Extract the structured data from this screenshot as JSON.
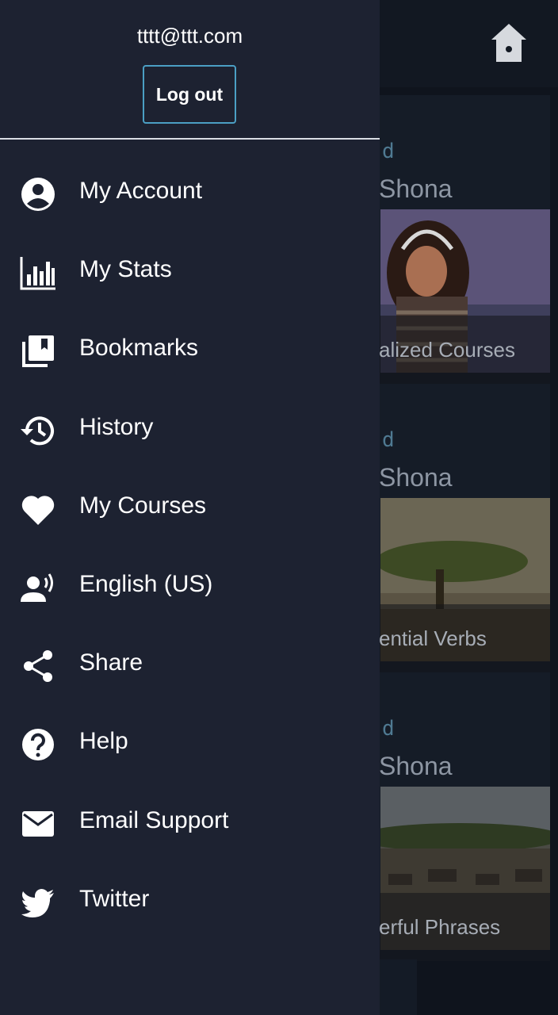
{
  "account": {
    "email": "tttt@ttt.com",
    "logout_label": "Log out"
  },
  "menu": [
    {
      "label": "My Account",
      "icon": "account-circle-icon"
    },
    {
      "label": "My Stats",
      "icon": "bar-chart-icon"
    },
    {
      "label": "Bookmarks",
      "icon": "bookmarks-icon"
    },
    {
      "label": "History",
      "icon": "history-icon"
    },
    {
      "label": "My Courses",
      "icon": "heart-icon"
    },
    {
      "label": "English (US)",
      "icon": "voice-language-icon"
    },
    {
      "label": "Share",
      "icon": "share-icon"
    },
    {
      "label": "Help",
      "icon": "help-icon"
    },
    {
      "label": "Email Support",
      "icon": "email-icon"
    },
    {
      "label": "Twitter",
      "icon": "twitter-icon"
    }
  ],
  "background_cards": [
    {
      "kicker": "d",
      "language": "Shona",
      "caption": "alized Courses"
    },
    {
      "kicker": "d",
      "language": "Shona",
      "caption": "ential Verbs"
    },
    {
      "kicker": "d",
      "language": "Shona",
      "caption": "erful Phrases"
    }
  ],
  "colors": {
    "drawer_bg": "#1d2231",
    "accent_border": "#4b9fc4",
    "text": "#ffffff"
  }
}
